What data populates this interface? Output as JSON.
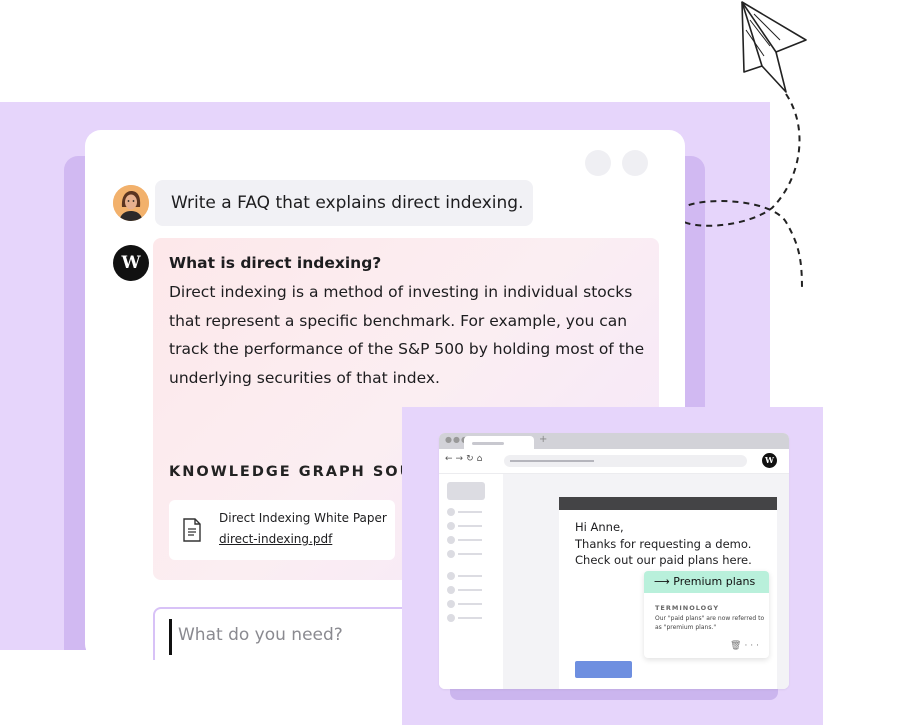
{
  "chat": {
    "user_prompt": "Write a FAQ that explains direct indexing.",
    "bot_logo": "W",
    "answer_title": "What is direct indexing?",
    "answer_body": "Direct indexing is a method of investing in individual stocks that represent a specific benchmark. For example, you can track the performance of the S&P 500 by holding most of the underlying securities of that index.",
    "knowledge_graph_title": "KNOWLEDGE GRAPH SOURCES",
    "source": {
      "name": "Direct Indexing White Paper",
      "file": "direct-indexing.pdf"
    },
    "input_placeholder": "What do you need?"
  },
  "browser": {
    "tab_plus": "+",
    "logo": "W",
    "email": {
      "greeting": "Hi Anne,",
      "line1": "Thanks for requesting a demo.",
      "line2": "Check out our paid plans here."
    },
    "popup": {
      "title": "⟶ Premium plans",
      "tag": "TERMINOLOGY",
      "description": "Our \"paid plans\" are now referred to as \"premium plans.\""
    }
  },
  "colors": {
    "background_purple": "#e6d5fb",
    "accent_purple": "#d8c2f7",
    "popup_green": "#b9f0db",
    "button_blue": "#6e8fe0"
  },
  "icons": [
    "user-avatar",
    "writer-logo-icon",
    "document-icon",
    "paper-plane-icon",
    "trash-icon",
    "more-icon"
  ]
}
